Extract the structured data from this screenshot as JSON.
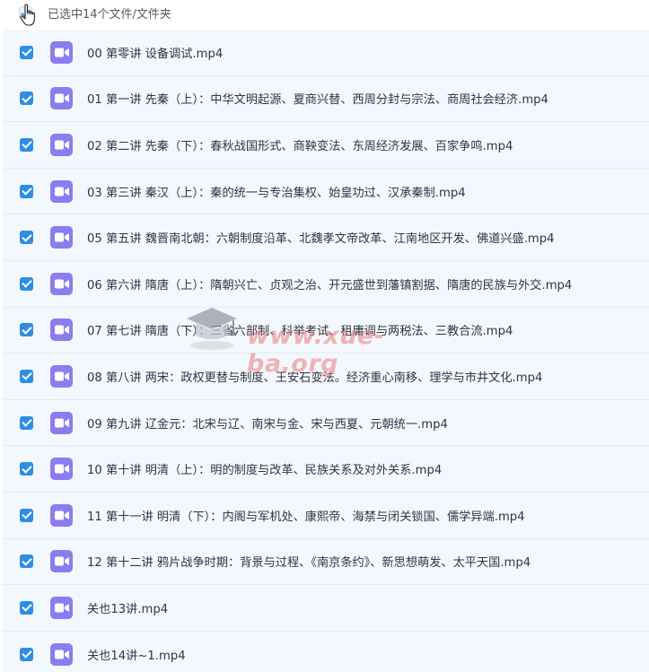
{
  "header": {
    "summary": "已选中14个文件/文件夹"
  },
  "files": [
    {
      "name": "00 第零讲 设备调试.mp4"
    },
    {
      "name": "01 第一讲 先秦（上）：中华文明起源、夏商兴替、西周分封与宗法、商周社会经济.mp4"
    },
    {
      "name": "02 第二讲 先秦（下）：春秋战国形式、商鞅变法、东周经济发展、百家争鸣.mp4"
    },
    {
      "name": "03 第三讲 秦汉（上）：秦的统一与专治集权、始皇功过、汉承秦制.mp4"
    },
    {
      "name": "05 第五讲 魏晋南北朝：六朝制度沿革、北魏孝文帝改革、江南地区开发、佛道兴盛.mp4"
    },
    {
      "name": "06 第六讲 隋唐（上）：隋朝兴亡、贞观之治、开元盛世到藩镇割据、隋唐的民族与外交.mp4"
    },
    {
      "name": "07 第七讲 隋唐（下）：三省六部制、科举考试、租庸调与两税法、三教合流.mp4"
    },
    {
      "name": "08 第八讲 两宋：政权更替与制度、王安石变法。经济重心南移、理学与市井文化.mp4"
    },
    {
      "name": "09 第九讲 辽金元：北宋与辽、南宋与金、宋与西夏、元朝统一.mp4"
    },
    {
      "name": "10 第十讲 明清（上）：明的制度与改革、民族关系及对外关系.mp4"
    },
    {
      "name": "11 第十一讲 明清（下）：内阁与军机处、康熙帝、海禁与闭关锁国、儒学异端.mp4"
    },
    {
      "name": "12 第十二讲 鸦片战争时期：背景与过程、《南京条约》、新思想萌发、太平天国.mp4"
    },
    {
      "name": "关也13讲.mp4"
    },
    {
      "name": "关也14讲~1.mp4"
    }
  ],
  "watermark": {
    "text": "www.xue-ba.org"
  },
  "colors": {
    "checkbox": "#2f8de4",
    "video_icon": "#8c7cf0",
    "row_background": "#f3f8fe"
  }
}
